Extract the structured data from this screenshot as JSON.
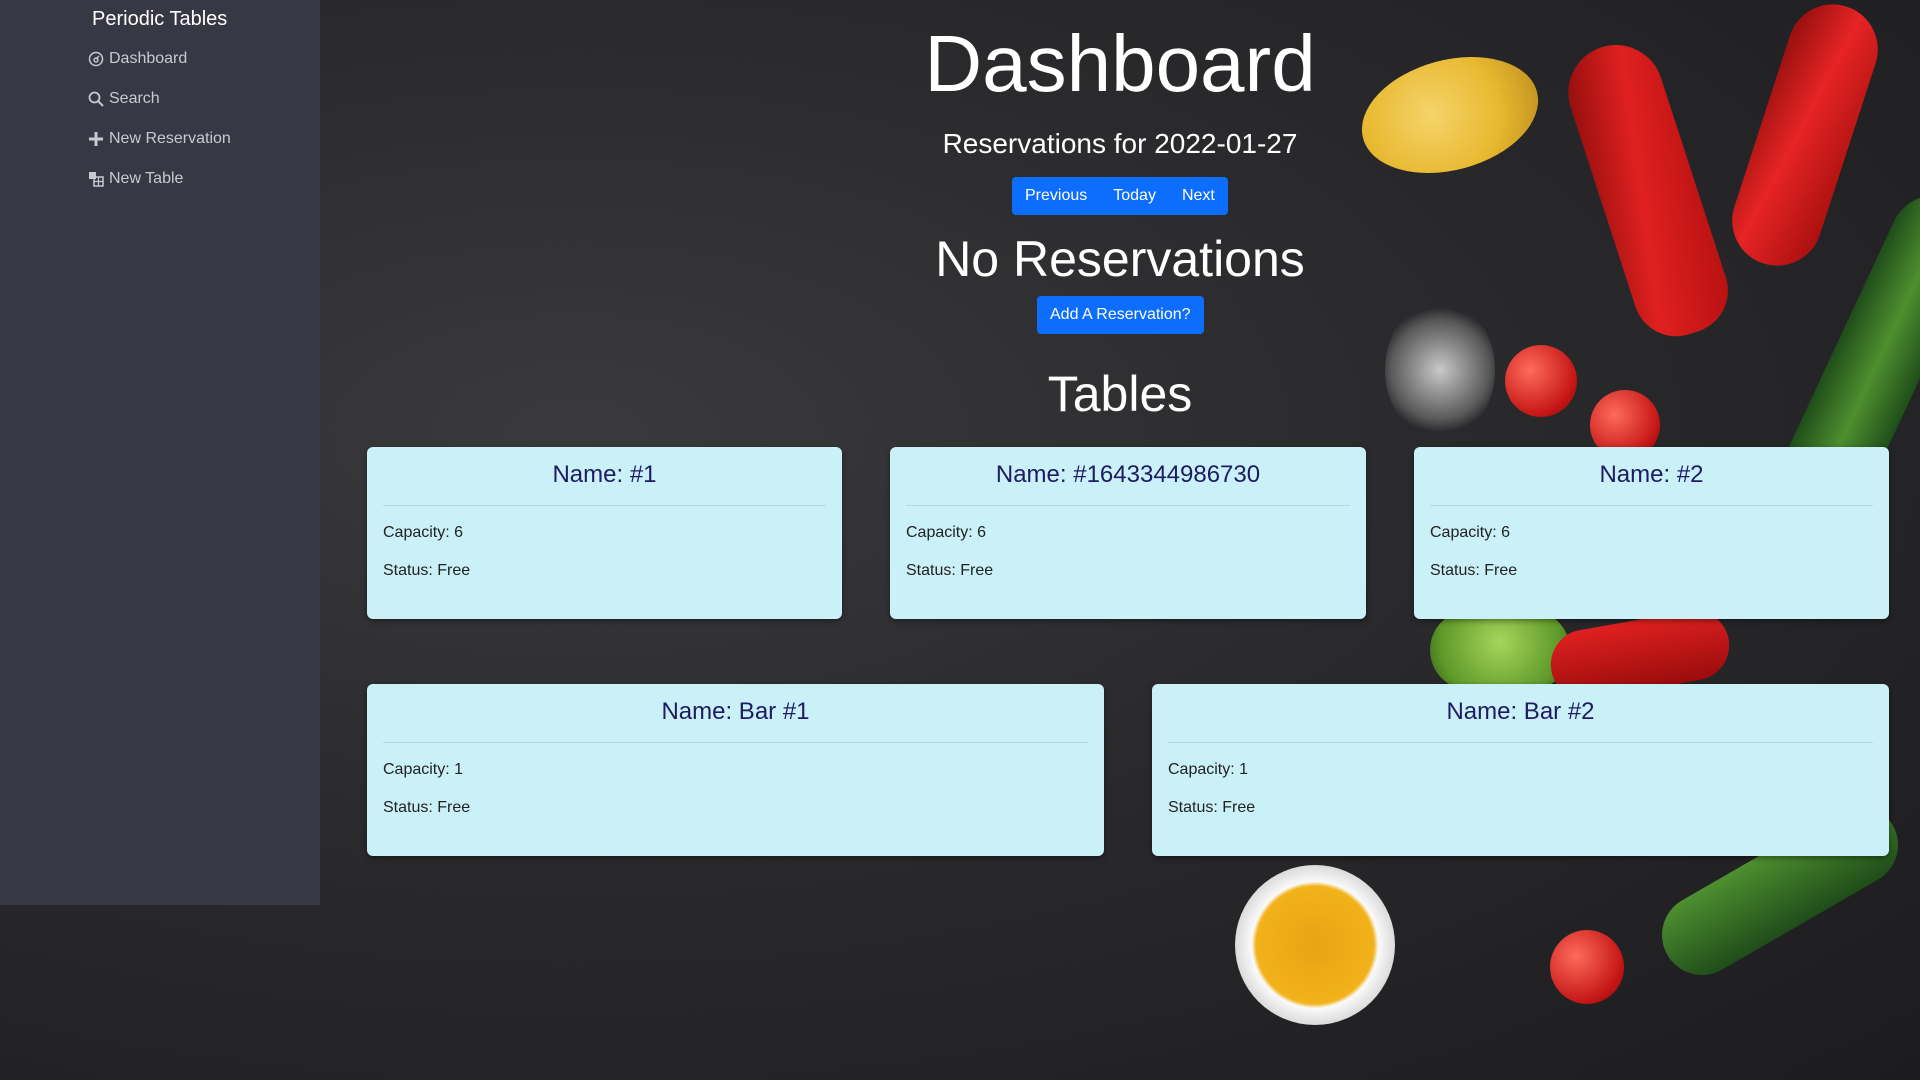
{
  "sidebar": {
    "brand": "Periodic Tables",
    "items": [
      {
        "label": "Dashboard",
        "icon": "dashboard-icon"
      },
      {
        "label": "Search",
        "icon": "search-icon"
      },
      {
        "label": "New Reservation",
        "icon": "plus-icon"
      },
      {
        "label": "New Table",
        "icon": "table-icon"
      }
    ]
  },
  "main": {
    "title": "Dashboard",
    "subtitle": "Reservations for 2022-01-27",
    "nav_buttons": {
      "previous": "Previous",
      "today": "Today",
      "next": "Next"
    },
    "no_reservations": "No Reservations",
    "add_reservation": "Add A Reservation?",
    "tables_title": "Tables"
  },
  "tables": [
    {
      "name": "Name: #1",
      "capacity": "Capacity: 6",
      "status": "Status: Free"
    },
    {
      "name": "Name: #1643344986730",
      "capacity": "Capacity: 6",
      "status": "Status: Free"
    },
    {
      "name": "Name: #2",
      "capacity": "Capacity: 6",
      "status": "Status: Free"
    },
    {
      "name": "Name: Bar #1",
      "capacity": "Capacity: 1",
      "status": "Status: Free"
    },
    {
      "name": "Name: Bar #2",
      "capacity": "Capacity: 1",
      "status": "Status: Free"
    }
  ],
  "colors": {
    "sidebar": "#373844",
    "button": "#0d6efd",
    "card": "#caf0f8",
    "card_title": "#1e1b63"
  }
}
